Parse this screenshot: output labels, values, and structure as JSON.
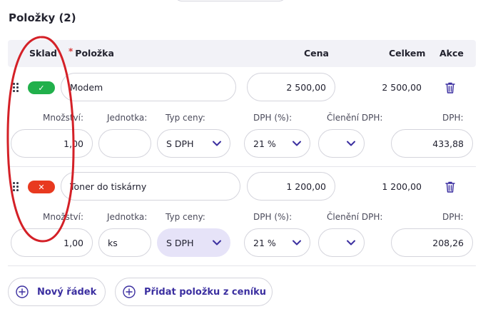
{
  "section": {
    "title": "Položky (2)"
  },
  "table_header": {
    "sklad": "Sklad",
    "required_mark": "*",
    "polozka": "Položka",
    "cena": "Cena",
    "celkem": "Celkem",
    "akce": "Akce"
  },
  "detail_labels": {
    "mnozstvi": "Množství:",
    "jednotka": "Jednotka:",
    "typ_ceny": "Typ ceny:",
    "dph_pct": "DPH (%):",
    "cleneni_dph": "Členění DPH:",
    "dph": "DPH:"
  },
  "items": [
    {
      "stock_status": "in-stock",
      "stock_icon": "✓",
      "name": "Modem",
      "price": "2 500,00",
      "total": "2 500,00",
      "quantity": "1,00",
      "unit": "",
      "price_type": "S DPH",
      "vat_rate": "21 %",
      "vat_breakdown": "",
      "vat": "433,88"
    },
    {
      "stock_status": "out-of-stock",
      "stock_icon": "✕",
      "name": "Toner do tiskárny",
      "price": "1 200,00",
      "total": "1 200,00",
      "quantity": "1,00",
      "unit": "ks",
      "price_type": "S DPH",
      "vat_rate": "21 %",
      "vat_breakdown": "",
      "vat": "208,26"
    }
  ],
  "actions": {
    "new_row": "Nový řádek",
    "add_from_pricelist": "Přidat položku z ceníku"
  },
  "colors": {
    "accent": "#3b2fa0",
    "in_stock": "#21b04b",
    "out_of_stock": "#e8391f",
    "annotation": "#d42027"
  }
}
